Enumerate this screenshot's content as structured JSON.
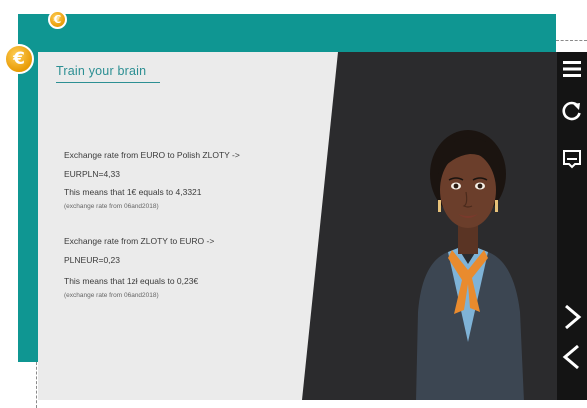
{
  "badges": {
    "small": "€",
    "large": "€"
  },
  "lesson": {
    "title": "Train your brain",
    "blocks": [
      {
        "heading": "Exchange rate from EURO to Polish ZLOTY ->",
        "formula": "EURPLN=4,33",
        "meaning": "This means that 1€ equals to 4,3321",
        "source": "(exchange rate from 06and2018)"
      },
      {
        "heading": "Exchange rate from ZLOTY to EURO ->",
        "formula": "PLNEUR=0,23",
        "meaning": "This means that 1zł equals to 0,23€",
        "source": "(exchange rate from 06and2018)"
      }
    ]
  },
  "toolbar": {
    "icons": [
      "menu-icon",
      "refresh-icon",
      "subtitles-icon",
      "next-icon",
      "previous-icon"
    ]
  },
  "colors": {
    "teal": "#0f9692",
    "coin": "#f0a412",
    "title": "#2c8f93",
    "scene": "#2b2b2d",
    "panel": "#ebebeb"
  }
}
